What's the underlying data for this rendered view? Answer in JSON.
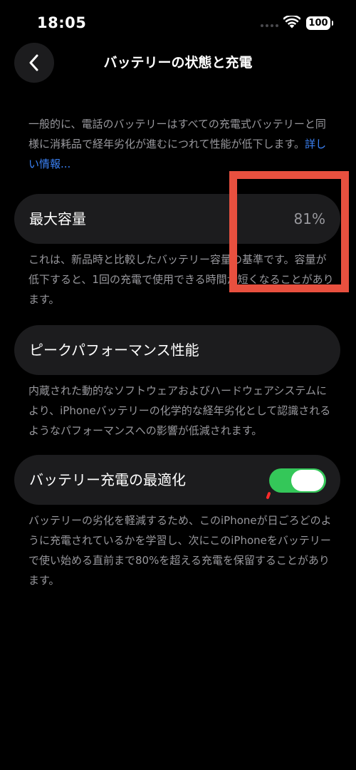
{
  "status_bar": {
    "time": "18:05",
    "battery_level": "100"
  },
  "nav": {
    "title": "バッテリーの状態と充電"
  },
  "intro": {
    "text": "一般的に、電話のバッテリーはすべての充電式バッテリーと同様に消耗品で経年劣化が進むにつれて性能が低下します。",
    "link": "詳しい情報..."
  },
  "max_capacity": {
    "label": "最大容量",
    "value": "81%",
    "footer": "これは、新品時と比較したバッテリー容量の基準です。容量が低下すると、1回の充電で使用できる時間が短くなることがあります。"
  },
  "peak_performance": {
    "label": "ピークパフォーマンス性能",
    "footer": "内蔵された動的なソフトウェアおよびハードウェアシステムにより、iPhoneバッテリーの化学的な経年劣化として認識されるようなパフォーマンスへの影響が低減されます。"
  },
  "optimized_charging": {
    "label": "バッテリー充電の最適化",
    "enabled": true,
    "footer": "バッテリーの劣化を軽減するため、このiPhoneが日ごろどのように充電されているかを学習し、次にこのiPhoneをバッテリーで使い始める直前まで80%を超える充電を保留することがあります。"
  },
  "colors": {
    "background": "#000000",
    "cell": "#1c1c1e",
    "secondary_text": "#98989d",
    "link": "#3b82f6",
    "toggle_on": "#34c759",
    "annotation": "#e8503f"
  }
}
